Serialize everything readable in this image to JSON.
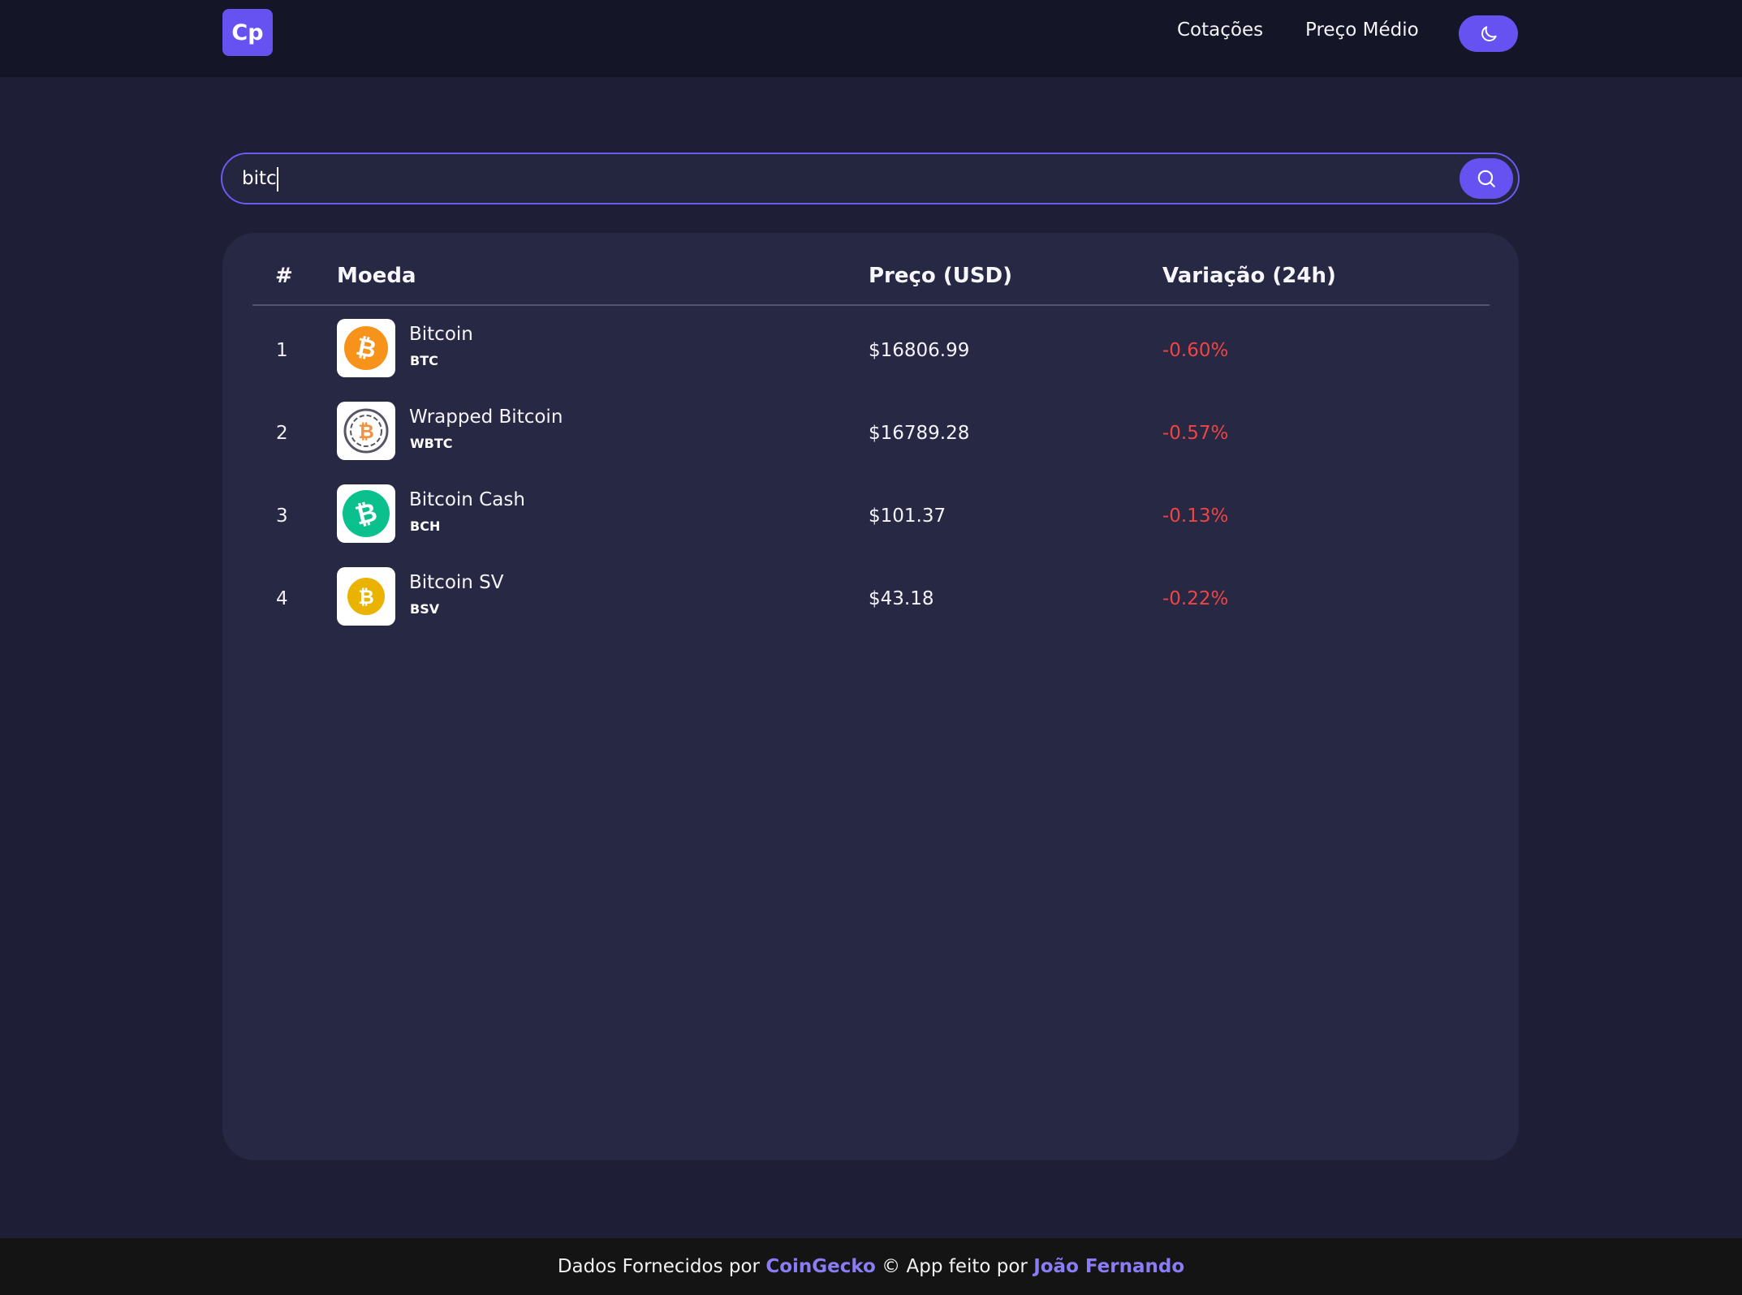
{
  "header": {
    "logo_text": "Cp",
    "nav": [
      {
        "label": "Cotações"
      },
      {
        "label": "Preço Médio"
      }
    ],
    "theme_toggle_icon": "moon-icon"
  },
  "search": {
    "value": "bitc",
    "button_icon": "search-icon"
  },
  "table": {
    "headers": {
      "rank": "#",
      "coin": "Moeda",
      "price": "Preço (USD)",
      "change": "Variação (24h)"
    },
    "rows": [
      {
        "rank": "1",
        "name": "Bitcoin",
        "symbol": "BTC",
        "price": "$16806.99",
        "change": "-0.60%",
        "icon": "bitcoin-icon",
        "color": "#f7931a"
      },
      {
        "rank": "2",
        "name": "Wrapped Bitcoin",
        "symbol": "WBTC",
        "price": "$16789.28",
        "change": "-0.57%",
        "icon": "wrapped-bitcoin-icon",
        "color": "#f09242"
      },
      {
        "rank": "3",
        "name": "Bitcoin Cash",
        "symbol": "BCH",
        "price": "$101.37",
        "change": "-0.13%",
        "icon": "bitcoin-cash-icon",
        "color": "#0ac18e"
      },
      {
        "rank": "4",
        "name": "Bitcoin SV",
        "symbol": "BSV",
        "price": "$43.18",
        "change": "-0.22%",
        "icon": "bitcoin-sv-icon",
        "color": "#eab300"
      }
    ]
  },
  "footer": {
    "prefix": "Dados Fornecidos por ",
    "source_link": "CoinGecko",
    "middle": " © App feito por ",
    "author_link": "João Fernando"
  },
  "colors": {
    "accent": "#6552f0",
    "negative": "#ef4444",
    "background": "#1e1f37",
    "card": "#272844"
  }
}
